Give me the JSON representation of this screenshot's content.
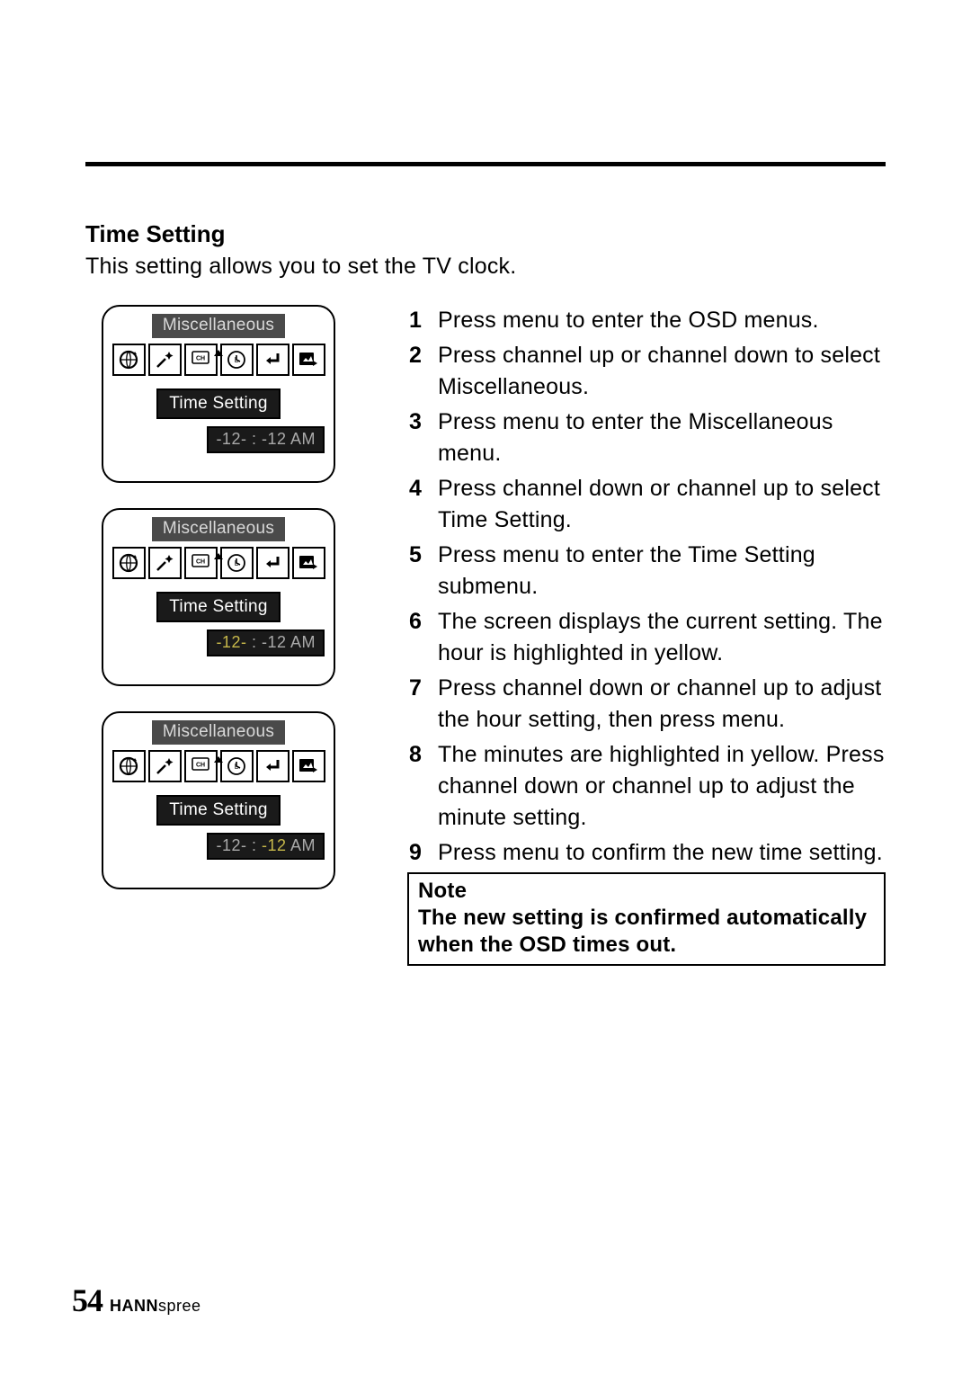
{
  "section": {
    "title": "Time Setting",
    "intro": "This setting allows you to set the TV clock."
  },
  "osd": {
    "title": "Miscellaneous",
    "sub_label": "Time Setting",
    "time_plain": "-12-  :  -12 AM",
    "time_hour_hl": "-12-",
    "time_sep": "  :  ",
    "time_rest": "-12 AM",
    "time_min_pre": "-12-  :  ",
    "time_min_hl": "-12",
    "time_min_post": " AM"
  },
  "steps": [
    "Press menu to enter the OSD menus.",
    "Press channel up or channel down to select Miscellaneous.",
    "Press menu to enter the Miscellaneous menu.",
    "Press channel down or channel up to select Time Setting.",
    "Press menu to enter the Time Setting submenu.",
    "The screen displays the current setting. The hour is highlighted in yellow.",
    "Press channel down or channel up to adjust the hour setting, then press menu.",
    "The minutes are highlighted in yellow. Press channel down or channel up to adjust the minute setting.",
    "Press menu to confirm the new time setting."
  ],
  "note": {
    "title": "Note",
    "body": "The new setting is confirmed automatically when the OSD times out."
  },
  "footer": {
    "page_num": "54",
    "brand_bold": "HANN",
    "brand_rest": "spree"
  },
  "icons": [
    "globe-refresh-icon",
    "star-wand-icon",
    "ch-box-icon",
    "clock-letter-icon",
    "return-arrow-icon",
    "picture-export-icon"
  ]
}
